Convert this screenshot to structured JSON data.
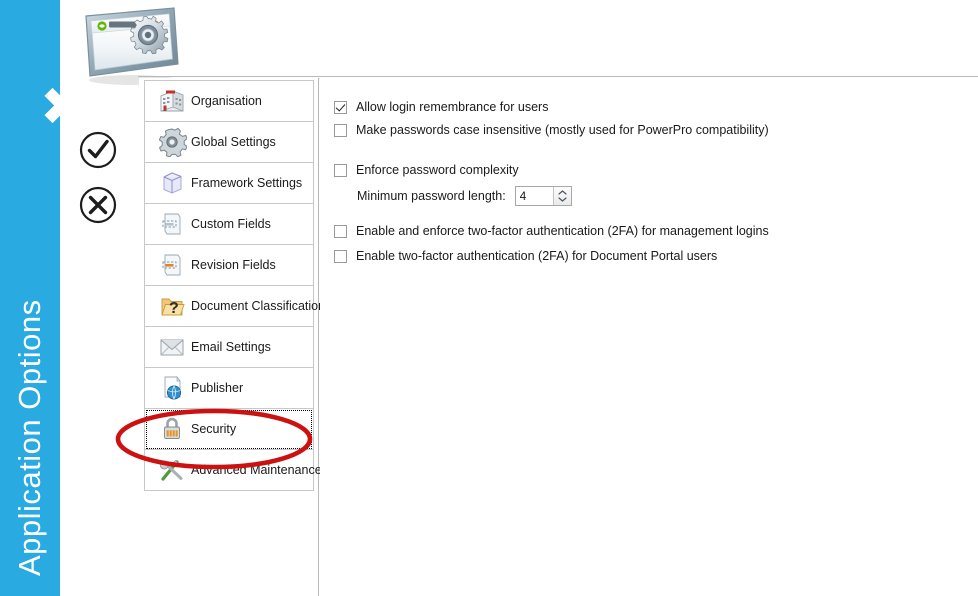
{
  "banner": {
    "title": "Application Options",
    "color": "#29ABE2"
  },
  "actions": {
    "ok_label": "OK",
    "cancel_label": "Cancel"
  },
  "sidebar": {
    "items": [
      {
        "label": "Organisation",
        "icon": "building-icon",
        "selected": false
      },
      {
        "label": "Global Settings",
        "icon": "gear-icon",
        "selected": false
      },
      {
        "label": "Framework Settings",
        "icon": "cube-icon",
        "selected": false
      },
      {
        "label": "Custom Fields",
        "icon": "document-field-icon",
        "selected": false
      },
      {
        "label": "Revision Fields",
        "icon": "document-revision-icon",
        "selected": false
      },
      {
        "label": "Document Classifications",
        "icon": "folder-question-icon",
        "selected": false
      },
      {
        "label": "Email Settings",
        "icon": "envelope-icon",
        "selected": false
      },
      {
        "label": "Publisher",
        "icon": "globe-document-icon",
        "selected": false
      },
      {
        "label": "Security",
        "icon": "padlock-icon",
        "selected": true
      },
      {
        "label": "Advanced Maintenance",
        "icon": "tools-icon",
        "selected": false
      }
    ]
  },
  "content": {
    "checkboxes": [
      {
        "label": "Allow login remembrance for users",
        "checked": true
      },
      {
        "label": "Make passwords case insensitive (mostly used for PowerPro compatibility)",
        "checked": false
      },
      {
        "label": "Enforce password complexity",
        "checked": false
      },
      {
        "label": "Enable and enforce two-factor authentication (2FA) for management logins",
        "checked": false
      },
      {
        "label": "Enable two-factor authentication (2FA) for Document Portal users",
        "checked": false
      }
    ],
    "min_password_length": {
      "label": "Minimum password length:",
      "value": "4"
    }
  },
  "annotation": {
    "shape": "ellipse",
    "color": "#CC1111",
    "target": "Security"
  }
}
